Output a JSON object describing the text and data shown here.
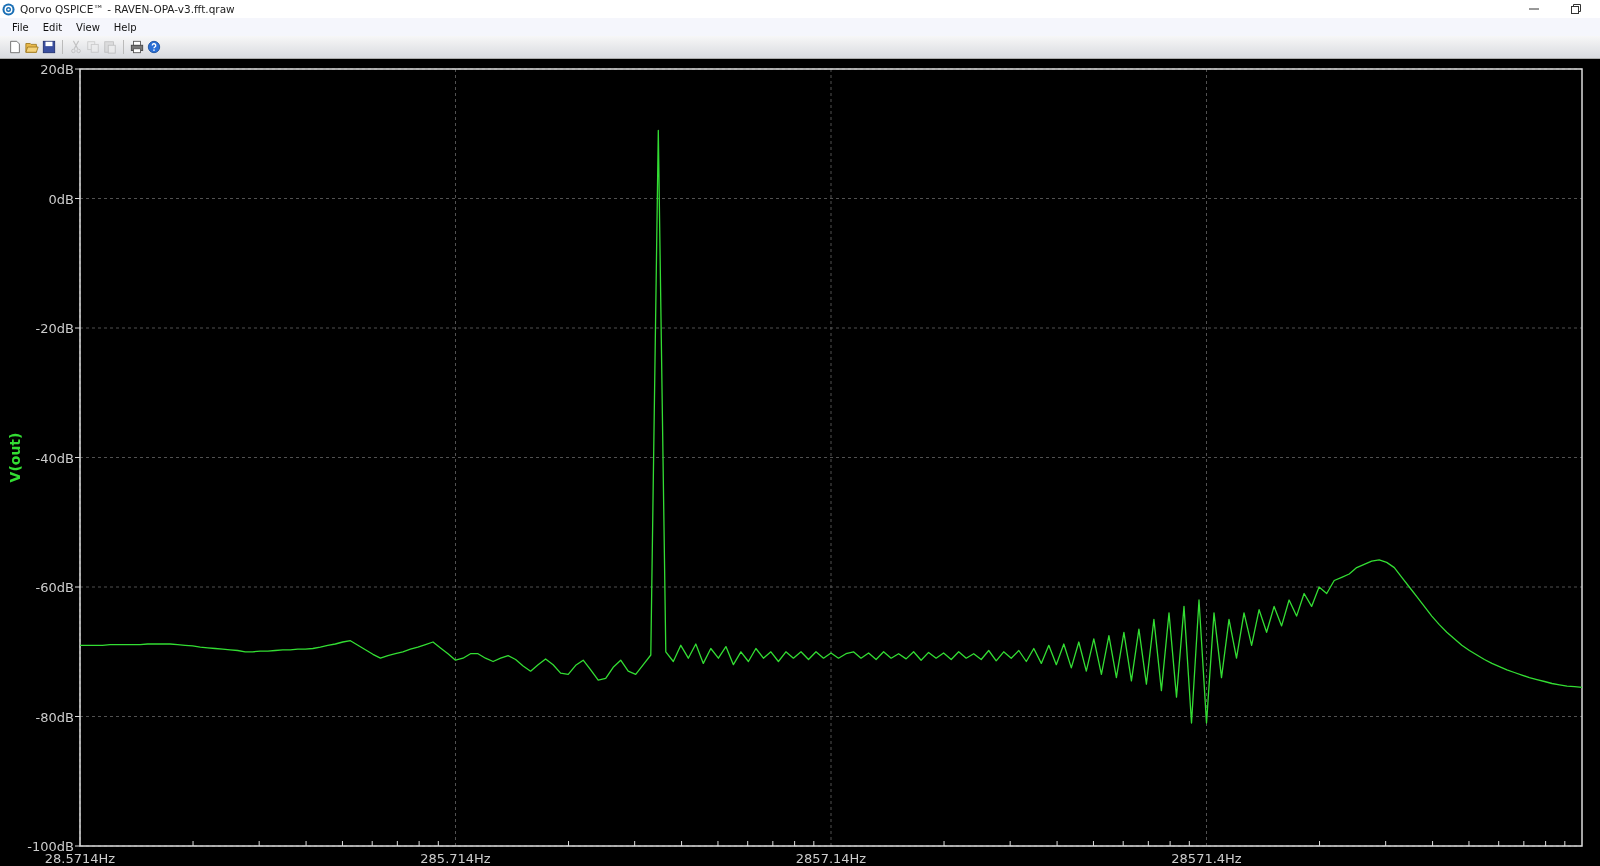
{
  "window": {
    "title": "Qorvo QSPICE™ - RAVEN-OPA-v3.fft.qraw"
  },
  "menu": [
    "File",
    "Edit",
    "View",
    "Help"
  ],
  "toolbar": [
    {
      "kind": "new",
      "disabled": false
    },
    {
      "kind": "open",
      "disabled": false
    },
    {
      "kind": "save",
      "disabled": false
    },
    {
      "kind": "cut",
      "disabled": true
    },
    {
      "kind": "copy",
      "disabled": true
    },
    {
      "kind": "paste",
      "disabled": true
    },
    {
      "kind": "print",
      "disabled": false
    },
    {
      "kind": "help",
      "disabled": false
    }
  ],
  "plot": {
    "chart_data": {
      "type": "line",
      "grid": true,
      "ylim": [
        -100,
        20
      ],
      "yticks": [
        {
          "value": 20,
          "label": "20dB"
        },
        {
          "value": 0,
          "label": "0dB"
        },
        {
          "value": -20,
          "label": "-20dB"
        },
        {
          "value": -40,
          "label": "-40dB"
        },
        {
          "value": -60,
          "label": "-60dB"
        },
        {
          "value": -80,
          "label": "-80dB"
        },
        {
          "value": -100,
          "label": "-100dB"
        }
      ],
      "categories": [
        "28.5714Hz",
        null,
        null,
        null,
        null,
        null,
        null,
        null,
        null,
        null,
        null,
        null,
        null,
        null,
        null,
        null,
        null,
        null,
        null,
        null,
        null,
        null,
        null,
        null,
        null,
        null,
        null,
        null,
        null,
        null,
        null,
        null,
        null,
        null,
        null,
        null,
        null,
        null,
        null,
        null,
        null,
        null,
        null,
        null,
        null,
        null,
        null,
        null,
        null,
        null,
        "285.714Hz",
        null,
        null,
        null,
        null,
        null,
        null,
        null,
        null,
        null,
        null,
        null,
        null,
        null,
        null,
        null,
        null,
        null,
        null,
        null,
        null,
        null,
        null,
        null,
        null,
        null,
        null,
        null,
        null,
        null,
        null,
        null,
        null,
        null,
        null,
        null,
        null,
        null,
        null,
        null,
        null,
        null,
        null,
        null,
        null,
        null,
        null,
        null,
        null,
        null,
        "2857.14Hz",
        null,
        null,
        null,
        null,
        null,
        null,
        null,
        null,
        null,
        null,
        null,
        null,
        null,
        null,
        null,
        null,
        null,
        null,
        null,
        null,
        null,
        null,
        null,
        null,
        null,
        null,
        null,
        null,
        null,
        null,
        null,
        null,
        null,
        null,
        null,
        null,
        null,
        null,
        null,
        null,
        null,
        null,
        null,
        null,
        null,
        null,
        null,
        null,
        null,
        "28571.4Hz",
        null,
        null,
        null,
        null,
        null,
        null,
        null,
        null,
        null,
        null,
        null,
        null,
        null,
        null,
        null,
        null,
        null,
        null,
        null,
        null,
        null,
        null,
        null,
        null,
        null,
        null,
        null,
        null,
        null,
        null,
        null,
        null,
        null,
        null,
        null,
        null,
        null,
        null,
        null,
        null,
        null,
        null,
        null,
        null,
        null,
        null,
        null,
        null,
        null,
        null
      ],
      "series": [
        {
          "name": "V(out)",
          "color": "#33dd33",
          "values": [
            -69,
            -69,
            -69,
            -69,
            -68.9,
            -68.9,
            -68.9,
            -68.9,
            -68.9,
            -68.8,
            -68.8,
            -68.8,
            -68.8,
            -68.9,
            -69,
            -69.1,
            -69.3,
            -69.4,
            -69.5,
            -69.6,
            -69.7,
            -69.8,
            -70,
            -70,
            -69.9,
            -69.9,
            -69.8,
            -69.7,
            -69.7,
            -69.6,
            -69.6,
            -69.5,
            -69.3,
            -69,
            -68.8,
            -68.5,
            -68.3,
            -69,
            -69.7,
            -70.4,
            -71,
            -70.6,
            -70.3,
            -70,
            -69.6,
            -69.3,
            -68.9,
            -68.5,
            -69.4,
            -70.3,
            -71.3,
            -71,
            -70.3,
            -70.3,
            -71,
            -71.5,
            -71,
            -70.6,
            -71.2,
            -72.2,
            -73,
            -72,
            -71.1,
            -72,
            -73.3,
            -73.5,
            -72.1,
            -71.3,
            -72.8,
            -74.4,
            -74.1,
            -72.4,
            -71.3,
            -73,
            -73.5,
            -72,
            -70.5,
            10.5,
            -70,
            -71.5,
            -69,
            -71,
            -68.8,
            -71.8,
            -69.5,
            -71,
            -69.2,
            -72,
            -70,
            -71.5,
            -69.5,
            -71,
            -70,
            -71.5,
            -70,
            -71,
            -70,
            -71.2,
            -70,
            -71,
            -70.2,
            -71,
            -70.3,
            -70,
            -71,
            -70.2,
            -71.2,
            -70,
            -71,
            -70.3,
            -71.1,
            -70,
            -71.3,
            -70.1,
            -71,
            -70.2,
            -71.2,
            -70,
            -71,
            -70.3,
            -71.2,
            -69.8,
            -71.4,
            -70,
            -71,
            -69.8,
            -71.5,
            -69.5,
            -71.8,
            -69,
            -72,
            -68.8,
            -72.5,
            -68.5,
            -73,
            -68,
            -73.5,
            -67.5,
            -74,
            -67,
            -74.5,
            -66.5,
            -75,
            -65,
            -76,
            -64,
            -77,
            -63,
            -81,
            -62,
            -81,
            -64,
            -74,
            -65,
            -71,
            -64,
            -69,
            -63.5,
            -67,
            -63,
            -66,
            -62,
            -64.5,
            -61,
            -63,
            -60,
            -61,
            -59,
            -58.5,
            -58,
            -57,
            -56.5,
            -56,
            -55.8,
            -56.2,
            -57,
            -58.5,
            -60,
            -61.5,
            -63,
            -64.5,
            -65.8,
            -67,
            -68,
            -69,
            -69.8,
            -70.5,
            -71.2,
            -71.8,
            -72.3,
            -72.8,
            -73.2,
            -73.6,
            -74,
            -74.3,
            -74.6,
            -74.9,
            -75.1,
            -75.3,
            -75.4,
            -75.5
          ]
        }
      ]
    }
  }
}
